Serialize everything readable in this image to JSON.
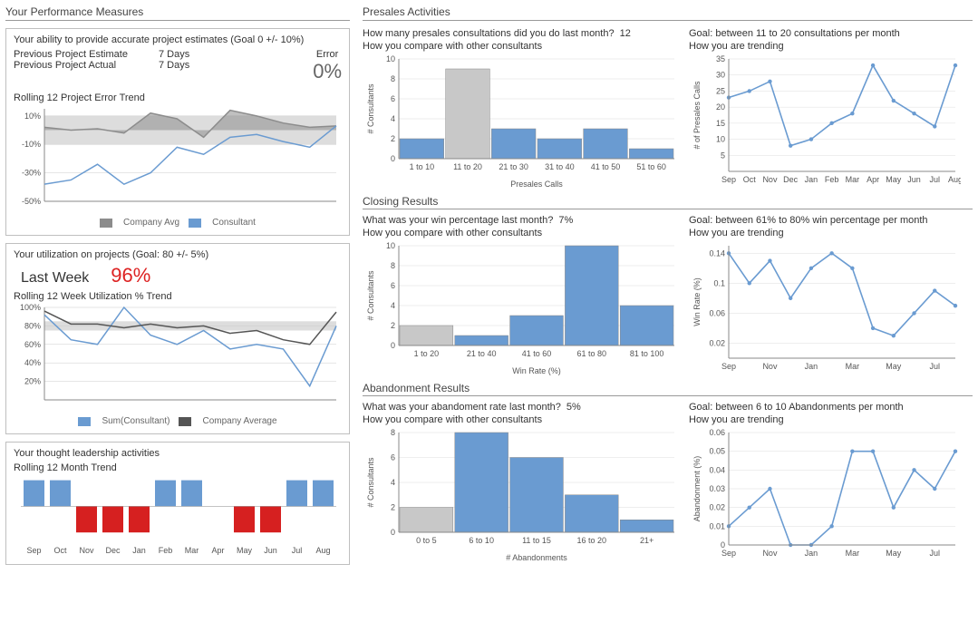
{
  "headers": {
    "left": "Your Performance Measures",
    "presales": "Presales Activities",
    "closing": "Closing Results",
    "aband": "Abandonment Results"
  },
  "estimates": {
    "title": "Your ability to provide accurate project estimates (Goal 0 +/- 10%)",
    "prev_est_label": "Previous Project Estimate",
    "prev_est_val": "7 Days",
    "prev_act_label": "Previous Project Actual",
    "prev_act_val": "7 Days",
    "error_label": "Error",
    "error_val": "0%",
    "trend_title": "Rolling 12 Project Error Trend",
    "legend_avg": "Company Avg",
    "legend_con": "Consultant"
  },
  "utilization": {
    "title": "Your utilization on projects (Goal: 80 +/- 5%)",
    "lastweek_label": "Last Week",
    "lastweek_val": "96%",
    "trend_title": "Rolling 12 Week Utilization % Trend",
    "legend_con": "Sum(Consultant)",
    "legend_avg": "Company Average"
  },
  "thought": {
    "title": "Your thought leadership activities",
    "trend_title": "Rolling 12 Month Trend"
  },
  "presales": {
    "q": "How many presales consultations did you do last month?",
    "ans": "12",
    "goal": "Goal: between 11 to 20 consultations per month",
    "compare": "How you compare with other consultants",
    "trend": "How you are trending"
  },
  "closing": {
    "q": "What was your win percentage last month?",
    "ans": "7%",
    "goal": "Goal: between 61% to 80% win percentage per month",
    "compare": "How you compare with other consultants",
    "trend": "How you are trending"
  },
  "aband": {
    "q": "What was your abandoment rate last month?",
    "ans": "5%",
    "goal": "Goal: between 6 to 10 Abandonments per month",
    "compare": "How you compare with other consultants",
    "trend": "How you are trending"
  },
  "axis_labels": {
    "presales_x": "Presales Calls",
    "presales_y": "# Consultants",
    "presales_trend_y": "# of Presales Calls",
    "closing_x": "Win Rate (%)",
    "closing_y": "# Consultants",
    "closing_trend_y": "Win Rate (%)",
    "aband_x": "# Abandonments",
    "aband_y": "# Consultants",
    "aband_trend_y": "Abandonment (%)"
  },
  "chart_data": [
    {
      "id": "error_trend",
      "type": "line",
      "ylim": [
        -50,
        15
      ],
      "yticks": [
        10,
        -10,
        -30,
        -50
      ],
      "series": [
        {
          "name": "Company Avg",
          "color": "#8c8c8c",
          "fill": true,
          "values": [
            2,
            0,
            1,
            -2,
            12,
            8,
            -5,
            14,
            10,
            5,
            2,
            3
          ]
        },
        {
          "name": "Consultant",
          "color": "#6a9bd1",
          "values": [
            -38,
            -35,
            -24,
            -38,
            -30,
            -12,
            -17,
            -5,
            -3,
            -8,
            -12,
            3
          ]
        }
      ],
      "band": {
        "low": -10,
        "high": 10
      }
    },
    {
      "id": "utilization_trend",
      "type": "line",
      "ylim": [
        0,
        100
      ],
      "yticks": [
        100,
        80,
        60,
        40,
        20
      ],
      "series": [
        {
          "name": "Consultant",
          "color": "#6a9bd1",
          "values": [
            92,
            65,
            60,
            100,
            70,
            60,
            75,
            55,
            60,
            55,
            15,
            80
          ]
        },
        {
          "name": "Company Average",
          "color": "#555",
          "values": [
            96,
            82,
            82,
            78,
            82,
            78,
            80,
            72,
            75,
            65,
            60,
            95
          ]
        }
      ],
      "band": {
        "low": 75,
        "high": 85
      }
    },
    {
      "id": "thought_trend",
      "type": "bar-diverge",
      "categories": [
        "Sep",
        "Oct",
        "Nov",
        "Dec",
        "Jan",
        "Feb",
        "Mar",
        "Apr",
        "May",
        "Jun",
        "Jul",
        "Aug"
      ],
      "up": [
        1,
        1,
        0,
        0,
        0,
        1,
        1,
        0,
        0,
        0,
        1,
        1
      ],
      "down": [
        0,
        0,
        1,
        1,
        1,
        0,
        0,
        0,
        1,
        1,
        0,
        0
      ]
    },
    {
      "id": "presales_hist",
      "type": "bar",
      "categories": [
        "1 to 10",
        "11 to 20",
        "21 to 30",
        "31 to 40",
        "41 to 50",
        "51 to 60"
      ],
      "values": [
        2,
        9,
        3,
        2,
        3,
        1
      ],
      "highlight_index": 1,
      "ylim": [
        0,
        10
      ],
      "yticks": [
        0,
        2,
        4,
        6,
        8,
        10
      ]
    },
    {
      "id": "presales_trend",
      "type": "line",
      "categories": [
        "Sep",
        "Oct",
        "Nov",
        "Dec",
        "Jan",
        "Feb",
        "Mar",
        "Apr",
        "May",
        "Jun",
        "Jul",
        "Aug"
      ],
      "values": [
        23,
        25,
        28,
        8,
        10,
        15,
        18,
        33,
        22,
        18,
        14,
        33
      ],
      "ylim": [
        0,
        35
      ],
      "yticks": [
        5,
        10,
        15,
        20,
        25,
        30,
        35
      ]
    },
    {
      "id": "closing_hist",
      "type": "bar",
      "categories": [
        "1 to 20",
        "21 to 40",
        "41 to 60",
        "61 to 80",
        "81 to 100"
      ],
      "values": [
        2,
        1,
        3,
        10,
        4
      ],
      "highlight_index": 0,
      "ylim": [
        0,
        10
      ],
      "yticks": [
        0,
        2,
        4,
        6,
        8,
        10
      ]
    },
    {
      "id": "closing_trend",
      "type": "line",
      "categories": [
        "Sep",
        "",
        "Nov",
        "",
        "Jan",
        "",
        "Mar",
        "",
        "May",
        "",
        "Jul",
        ""
      ],
      "values": [
        0.14,
        0.1,
        0.13,
        0.08,
        0.12,
        0.14,
        0.12,
        0.04,
        0.03,
        0.06,
        0.09,
        0.07
      ],
      "ylim": [
        0,
        0.15
      ],
      "yticks": [
        0.02,
        0.06,
        0.1,
        0.14
      ]
    },
    {
      "id": "aband_hist",
      "type": "bar",
      "categories": [
        "0 to 5",
        "6 to 10",
        "11 to 15",
        "16 to 20",
        "21+"
      ],
      "values": [
        2,
        8,
        6,
        3,
        1
      ],
      "highlight_index": 0,
      "ylim": [
        0,
        8
      ],
      "yticks": [
        0,
        2,
        4,
        6,
        8
      ]
    },
    {
      "id": "aband_trend",
      "type": "line",
      "categories": [
        "Sep",
        "",
        "Nov",
        "",
        "Jan",
        "",
        "Mar",
        "",
        "May",
        "",
        "Jul",
        ""
      ],
      "values": [
        0.01,
        0.02,
        0.03,
        0.0,
        0.0,
        0.01,
        0.05,
        0.05,
        0.02,
        0.04,
        0.03,
        0.05
      ],
      "ylim": [
        0,
        0.06
      ],
      "yticks": [
        0,
        0.01,
        0.02,
        0.03,
        0.04,
        0.05,
        0.06
      ]
    }
  ]
}
